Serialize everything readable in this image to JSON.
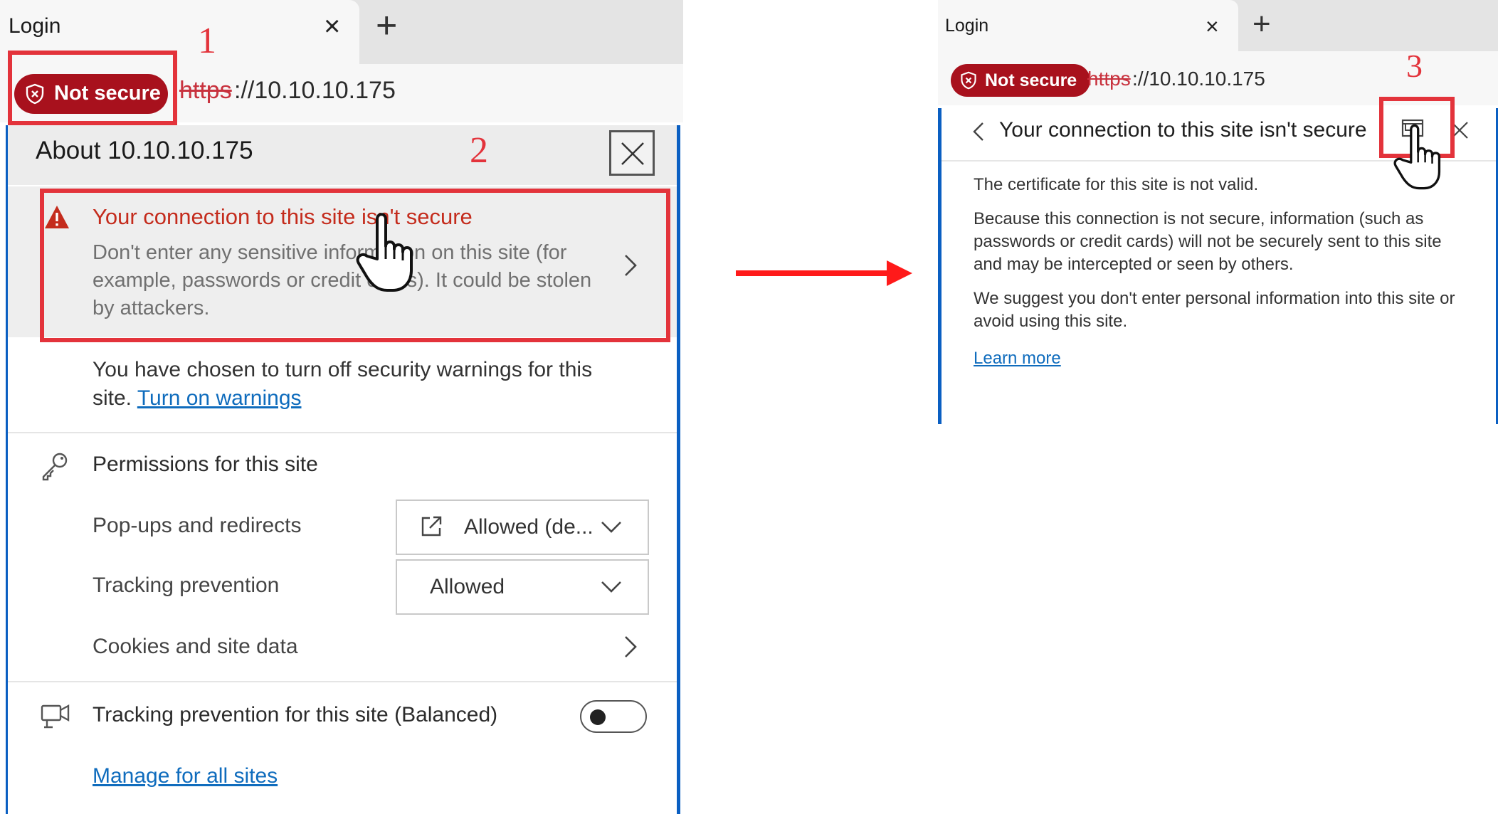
{
  "left": {
    "tab": {
      "title": "Login",
      "close": "×",
      "new_tab": "+"
    },
    "address": {
      "security_badge": "Not secure",
      "scheme": "https",
      "host_rest": "://10.10.10.175"
    },
    "popup": {
      "title": "About 10.10.10.175",
      "connection": {
        "title": "Your connection to this site isn't secure",
        "description": "Don't enter any sensitive information on this site (for example, passwords or credit cards). It could be stolen by attackers."
      },
      "warnings_text": "You have chosen to turn off security warnings for this site.",
      "warnings_link": "Turn on warnings",
      "permissions": {
        "title": "Permissions for this site",
        "popups_label": "Pop-ups and redirects",
        "popups_value": "Allowed (de...",
        "tracking_label": "Tracking prevention",
        "tracking_value": "Allowed",
        "cookies_label": "Cookies and site data"
      },
      "tracking_site": {
        "title": "Tracking prevention for this site (Balanced)",
        "toggle_on": false
      },
      "manage_link": "Manage for all sites"
    },
    "annotations": [
      "1",
      "2"
    ]
  },
  "right": {
    "tab": {
      "title": "Login",
      "close": "×",
      "new_tab": "+"
    },
    "address": {
      "security_badge": "Not secure",
      "scheme": "https",
      "host_rest": "://10.10.10.175"
    },
    "popup": {
      "title": "Your connection to this site isn't secure",
      "p1": "The certificate for this site is not valid.",
      "p2": "Because this connection is not secure, information (such as passwords or credit cards) will not be securely sent to this site and may be intercepted or seen by others.",
      "p3": "We suggest you don't enter personal information into this site or avoid using this site.",
      "learn_more": "Learn more"
    },
    "annotations": [
      "3"
    ]
  },
  "colors": {
    "badge_red": "#a8111d",
    "annotation_red": "#e3333b",
    "accent_blue": "#0a5fc2",
    "link_blue": "#0f6cbd",
    "warning_red": "#c42b1c",
    "arrow_red": "#ff1a1a"
  },
  "icons": [
    "shield-icon",
    "close-icon",
    "warning-icon",
    "chevron-right-icon",
    "key-icon",
    "external-window-icon",
    "chevron-down-icon",
    "camera-icon",
    "hand-cursor-icon",
    "chevron-left-icon",
    "open-in-new-window-icon"
  ]
}
